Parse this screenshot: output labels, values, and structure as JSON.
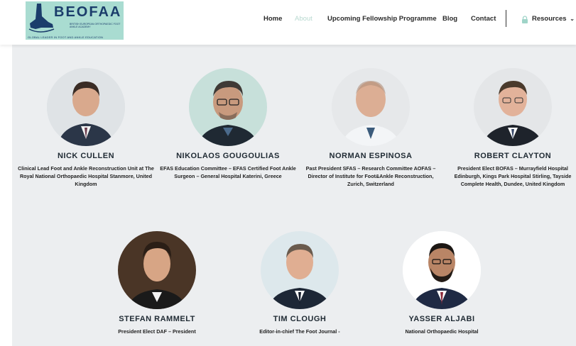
{
  "brand": {
    "name": "BEOFAA",
    "subtitle": "BRITISH EUROPEAN ORTHOPAEDIC FOOT ANKLE ACADEMY",
    "tagline": "GLOBAL LEADER IN FOOT AND ANKLE EDUCATION",
    "bg_color": "#a9dcd1",
    "text_color": "#1b3d6b"
  },
  "nav": {
    "items": [
      {
        "label": "Home",
        "active": false
      },
      {
        "label": "About",
        "active": true
      },
      {
        "label": "Upcoming Fellowship Programme",
        "active": false
      },
      {
        "label": "Blog",
        "active": false
      },
      {
        "label": "Contact",
        "active": false
      }
    ],
    "resources_label": "Resources",
    "resources_icon": "lock-icon",
    "active_color": "#b8d9d0",
    "lock_color": "#9fd4c8"
  },
  "faculty": [
    {
      "name": "NICK CULLEN",
      "role": "Clinical Lead Foot and Ankle Reconstruction Unit at The Royal National Orthopaedic Hospital Stanmore, United Kingdom"
    },
    {
      "name": "NIKOLAOS GOUGOULIAS",
      "role": "EFAS Education Committee – EFAS Certified Foot Ankle Surgeon – General Hospital Katerini, Greece"
    },
    {
      "name": "NORMAN ESPINOSA",
      "role": "Past President SFAS – Research Committee AOFAS – Director of Institute for Foot&Ankle Reconstruction, Zurich, Switzerland"
    },
    {
      "name": "ROBERT CLAYTON",
      "role": "President Elect BOFAS – Murrayfield Hospital Edinburgh, Kings Park Hospital Stirling, Tayside Complete Health, Dundee, United Kingdom"
    },
    {
      "name": "STEFAN RAMMELT",
      "role": "President Elect DAF – President"
    },
    {
      "name": "TIM CLOUGH",
      "role": "Editor-in-chief The Foot Journal -"
    },
    {
      "name": "YASSER ALJABI",
      "role": "National Orthopaedic Hospital"
    }
  ]
}
